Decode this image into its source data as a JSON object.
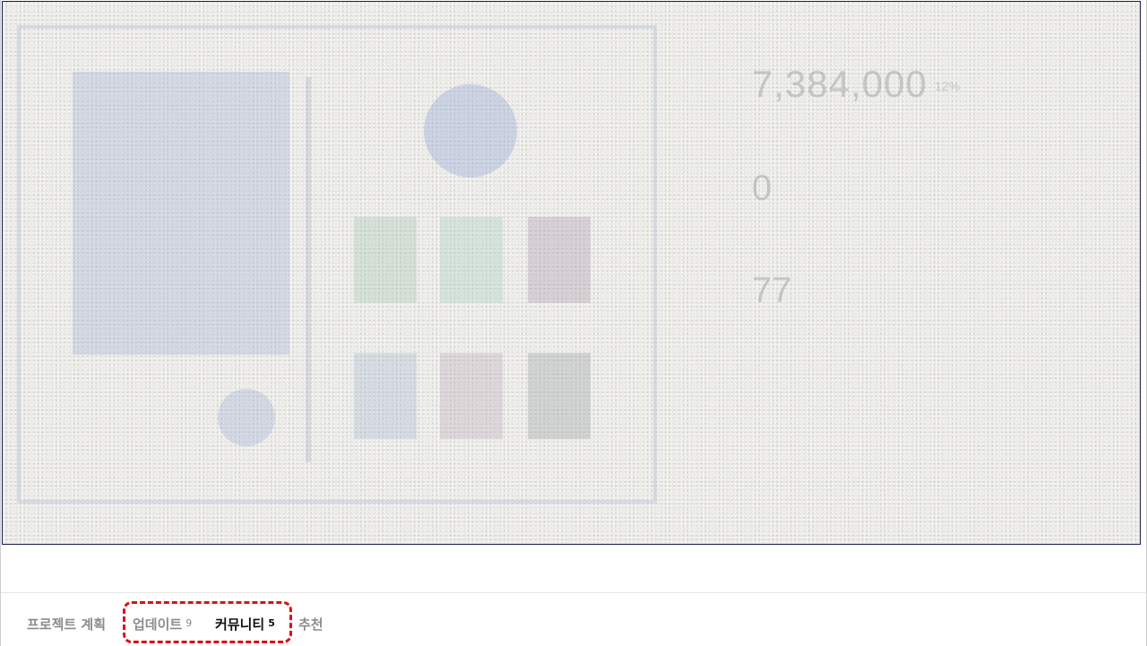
{
  "overlay": {
    "ghost_amount": "7,384,000",
    "ghost_unit": "12%",
    "ghost_value_2": "0",
    "ghost_value_3": "77"
  },
  "tabs": [
    {
      "label": "프로젝트 계획",
      "count": null,
      "active": false
    },
    {
      "label": "업데이트",
      "count": "9",
      "active": false
    },
    {
      "label": "커뮤니티",
      "count": "5",
      "active": true
    },
    {
      "label": "추천",
      "count": null,
      "active": false
    }
  ],
  "colors": {
    "active_tab": "#111111",
    "inactive_tab": "#8c8c8c",
    "highlight": "#e01010",
    "overlay_border": "#1a2150"
  }
}
